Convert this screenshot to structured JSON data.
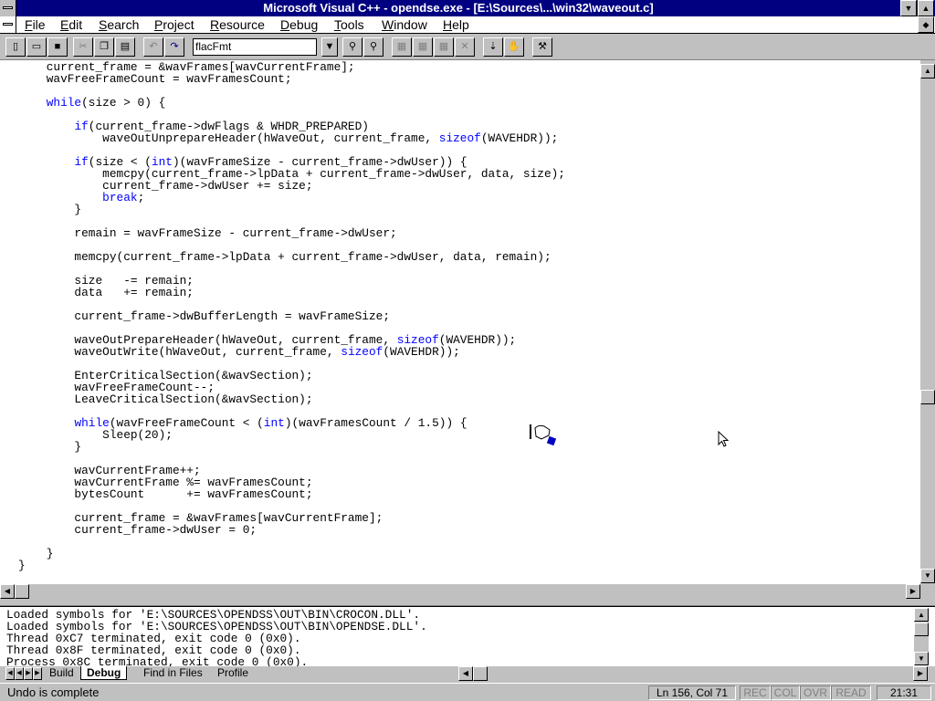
{
  "window": {
    "title": "Microsoft Visual C++ - opendse.exe - [E:\\Sources\\...\\win32\\waveout.c]"
  },
  "menu": [
    {
      "label": "File",
      "u": "F",
      "rest": "ile"
    },
    {
      "label": "Edit",
      "u": "E",
      "rest": "dit"
    },
    {
      "label": "Search",
      "u": "S",
      "rest": "earch"
    },
    {
      "label": "Project",
      "u": "P",
      "rest": "roject"
    },
    {
      "label": "Resource",
      "u": "R",
      "rest": "esource"
    },
    {
      "label": "Debug",
      "u": "D",
      "rest": "ebug"
    },
    {
      "label": "Tools",
      "u": "T",
      "rest": "ools"
    },
    {
      "label": "Window",
      "u": "W",
      "rest": "indow"
    },
    {
      "label": "Help",
      "u": "H",
      "rest": "elp"
    }
  ],
  "toolbar": {
    "find_value": "flacFmt"
  },
  "editor": {
    "lines": [
      "    current_frame = &wavFrames[wavCurrentFrame];",
      "    wavFreeFrameCount = wavFramesCount;",
      "",
      "    while(size > 0) {",
      "",
      "        if(current_frame->dwFlags & WHDR_PREPARED)",
      "            waveOutUnprepareHeader(hWaveOut, current_frame, sizeof(WAVEHDR));",
      "",
      "        if(size < (int)(wavFrameSize - current_frame->dwUser)) {",
      "            memcpy(current_frame->lpData + current_frame->dwUser, data, size);",
      "            current_frame->dwUser += size;",
      "            break;",
      "        }",
      "",
      "        remain = wavFrameSize - current_frame->dwUser;",
      "",
      "        memcpy(current_frame->lpData + current_frame->dwUser, data, remain);",
      "",
      "        size   -= remain;",
      "        data   += remain;",
      "",
      "        current_frame->dwBufferLength = wavFrameSize;",
      "",
      "        waveOutPrepareHeader(hWaveOut, current_frame, sizeof(WAVEHDR));",
      "        waveOutWrite(hWaveOut, current_frame, sizeof(WAVEHDR));",
      "",
      "        EnterCriticalSection(&wavSection);",
      "        wavFreeFrameCount--;",
      "        LeaveCriticalSection(&wavSection);",
      "",
      "        while(wavFreeFrameCount < (int)(wavFramesCount / 1.5)) {",
      "            Sleep(20);",
      "        }",
      "",
      "        wavCurrentFrame++;",
      "        wavCurrentFrame %= wavFramesCount;",
      "        bytesCount      += wavFramesCount;",
      "",
      "        current_frame = &wavFrames[wavCurrentFrame];",
      "        current_frame->dwUser = 0;",
      "",
      "    }",
      "}"
    ]
  },
  "output": {
    "lines": [
      "Loaded symbols for 'E:\\SOURCES\\OPENDSS\\OUT\\BIN\\CROCON.DLL'.",
      "Loaded symbols for 'E:\\SOURCES\\OPENDSS\\OUT\\BIN\\OPENDSE.DLL'.",
      "Thread 0xC7 terminated, exit code 0 (0x0).",
      "Thread 0x8F terminated, exit code 0 (0x0).",
      "Process 0x8C terminated, exit code 0 (0x0)."
    ]
  },
  "tabs": {
    "build": "Build",
    "debug": "Debug",
    "find": "Find in Files",
    "profile": "Profile"
  },
  "status": {
    "message": "Undo is complete",
    "position": "Ln 156, Col 71",
    "rec": "REC",
    "col": "COL",
    "ovr": "OVR",
    "read": "READ",
    "time": "21:31"
  }
}
